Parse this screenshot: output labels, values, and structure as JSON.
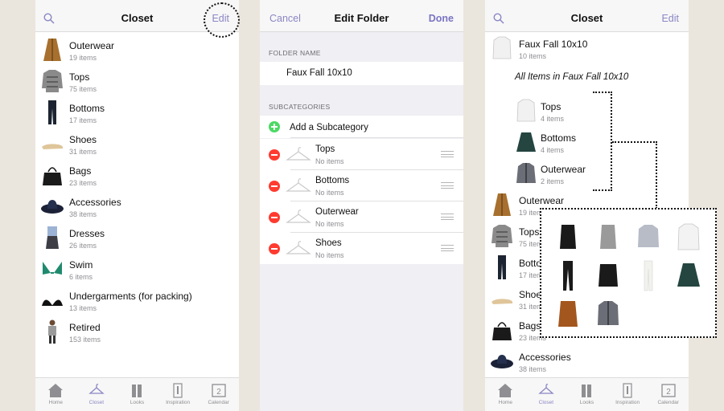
{
  "screen1": {
    "title": "Closet",
    "edit_label": "Edit",
    "items": [
      {
        "title": "Outerwear",
        "count": "19 items"
      },
      {
        "title": "Tops",
        "count": "75 items"
      },
      {
        "title": "Bottoms",
        "count": "17 items"
      },
      {
        "title": "Shoes",
        "count": "31 items"
      },
      {
        "title": "Bags",
        "count": "23 items"
      },
      {
        "title": "Accessories",
        "count": "38 items"
      },
      {
        "title": "Dresses",
        "count": "26 items"
      },
      {
        "title": "Swim",
        "count": "6 items"
      },
      {
        "title": "Undergarments (for packing)",
        "count": "13 items"
      },
      {
        "title": "Retired",
        "count": "153 items"
      }
    ]
  },
  "screen2": {
    "cancel_label": "Cancel",
    "title": "Edit Folder",
    "done_label": "Done",
    "folder_name_header": "FOLDER NAME",
    "folder_name_value": "Faux Fall 10x10",
    "subcategories_header": "SUBCATEGORIES",
    "add_label": "Add a Subcategory",
    "subcategories": [
      {
        "title": "Tops",
        "count": "No items"
      },
      {
        "title": "Bottoms",
        "count": "No items"
      },
      {
        "title": "Outerwear",
        "count": "No items"
      },
      {
        "title": "Shoes",
        "count": "No items"
      }
    ]
  },
  "screen3": {
    "title": "Closet",
    "edit_label": "Edit",
    "folder": {
      "title": "Faux Fall 10x10",
      "count": "10 items"
    },
    "all_items_label": "All Items in Faux Fall 10x10",
    "subfolders": [
      {
        "title": "Tops",
        "count": "4 items"
      },
      {
        "title": "Bottoms",
        "count": "4 items"
      },
      {
        "title": "Outerwear",
        "count": "2 items"
      }
    ],
    "items": [
      {
        "title": "Outerwear",
        "count": "19 items"
      },
      {
        "title": "Tops",
        "count": "75 items"
      },
      {
        "title": "Bottoms",
        "count": "17 items"
      },
      {
        "title": "Shoes",
        "count": "31 items"
      },
      {
        "title": "Bags",
        "count": "23 items"
      },
      {
        "title": "Accessories",
        "count": "38 items"
      }
    ]
  },
  "tabs": [
    {
      "label": "Home",
      "icon": "home-icon"
    },
    {
      "label": "Closet",
      "icon": "hanger-icon"
    },
    {
      "label": "Looks",
      "icon": "looks-icon"
    },
    {
      "label": "Inspiration",
      "icon": "inspiration-icon"
    },
    {
      "label": "Calendar",
      "icon": "calendar-icon",
      "badge": "2"
    }
  ],
  "colors": {
    "accent": "#8a86c4",
    "add": "#4cd964",
    "delete": "#ff3b30"
  }
}
